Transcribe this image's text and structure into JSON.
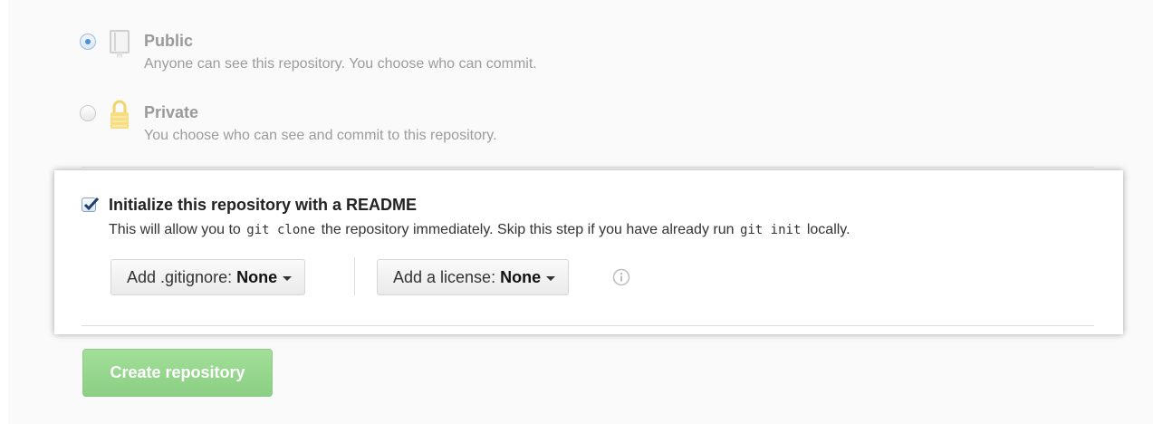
{
  "visibility": {
    "options": [
      {
        "title": "Public",
        "description": "Anyone can see this repository. You choose who can commit.",
        "checked": true,
        "icon": "repo-icon"
      },
      {
        "title": "Private",
        "description": "You choose who can see and commit to this repository.",
        "checked": false,
        "icon": "lock-icon"
      }
    ]
  },
  "init": {
    "checked": true,
    "title": "Initialize this repository with a README",
    "desc_part1": "This will allow you to ",
    "code1": "git clone",
    "desc_part2": " the repository immediately. Skip this step if you have already run ",
    "code2": "git init",
    "desc_part3": " locally."
  },
  "gitignore": {
    "label": "Add .gitignore: ",
    "value": "None"
  },
  "license": {
    "label": "Add a license: ",
    "value": "None"
  },
  "info_icon": "info-icon",
  "create_button": {
    "label": "Create repository",
    "color": "#8fd58a"
  },
  "colors": {
    "accent_blue": "#4a90d9",
    "lock_yellow": "#f3d868"
  }
}
